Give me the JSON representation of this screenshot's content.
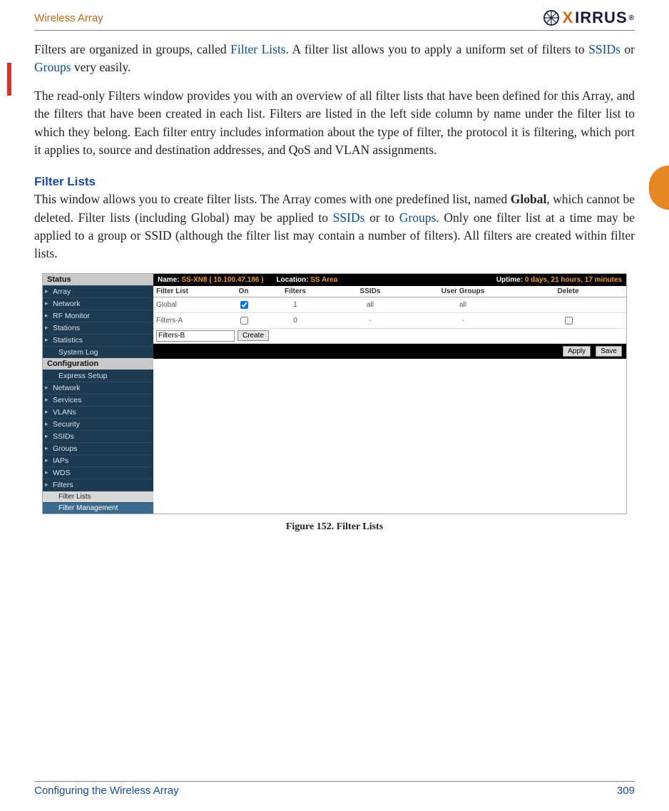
{
  "header": {
    "title": "Wireless Array",
    "logo_text_x": "X",
    "logo_text_rest": "IRRUS",
    "logo_mark": "®"
  },
  "para1_prefix": "Filters are organized in groups, called ",
  "para1_link1": "Filter Lists",
  "para1_mid1": ". A filter list allows you to apply a uniform set of filters to ",
  "para1_link2": "SSIDs",
  "para1_mid2": " or ",
  "para1_link3": "Groups",
  "para1_suffix": " very easily.",
  "para2": "The read-only Filters window provides you with an overview of all filter lists that have been defined for this Array, and the filters that have been created in each list. Filters are listed in the left side column by name under the filter list to which they belong. Each filter entry includes information about the type of filter, the protocol it is filtering, which port it applies to, source and destination addresses, and QoS and VLAN assignments.",
  "h2": "Filter Lists",
  "para3_prefix": "This window allows you to create filter lists. The Array comes with one predefined list, named ",
  "para3_bold": "Global",
  "para3_mid1": ", which cannot be deleted. Filter lists (including Global) may be applied to ",
  "para3_link1": "SSIDs",
  "para3_mid2": " or to ",
  "para3_link2": "Groups",
  "para3_suffix": ". Only one filter list at a time may be applied to a group or SSID (although the filter list may contain a number of filters). All filters are created within filter lists.",
  "screenshot": {
    "status_label": "Status",
    "config_label": "Configuration",
    "nav_status": [
      "Array",
      "Network",
      "RF Monitor",
      "Stations",
      "Statistics",
      "System Log"
    ],
    "nav_config": [
      "Express Setup",
      "Network",
      "Services",
      "VLANs",
      "Security",
      "SSIDs",
      "Groups",
      "IAPs",
      "WDS",
      "Filters"
    ],
    "nav_sub": [
      "Filter Lists",
      "Filter Management"
    ],
    "bar_name_label": "Name:",
    "bar_name_value": "SS-XN8   ( 10.100.47.186 )",
    "bar_loc_label": "Location:",
    "bar_loc_value": "SS Area",
    "bar_uptime_label": "Uptime:",
    "bar_uptime_value": "0 days, 21 hours, 17 minutes",
    "cols": {
      "name": "Filter List",
      "on": "On",
      "filters": "Filters",
      "ssids": "SSIDs",
      "groups": "User Groups",
      "del": "Delete"
    },
    "rows": [
      {
        "name": "Global",
        "on": true,
        "filters": "1",
        "ssids": "all",
        "groups": "all",
        "del": null
      },
      {
        "name": "Filters-A",
        "on": false,
        "filters": "0",
        "ssids": "-",
        "groups": "-",
        "del": false
      }
    ],
    "new_name": "Filters-B",
    "create_btn": "Create",
    "apply_btn": "Apply",
    "save_btn": "Save"
  },
  "caption": "Figure 152. Filter Lists",
  "footer": {
    "left": "Configuring the Wireless Array",
    "right": "309"
  }
}
